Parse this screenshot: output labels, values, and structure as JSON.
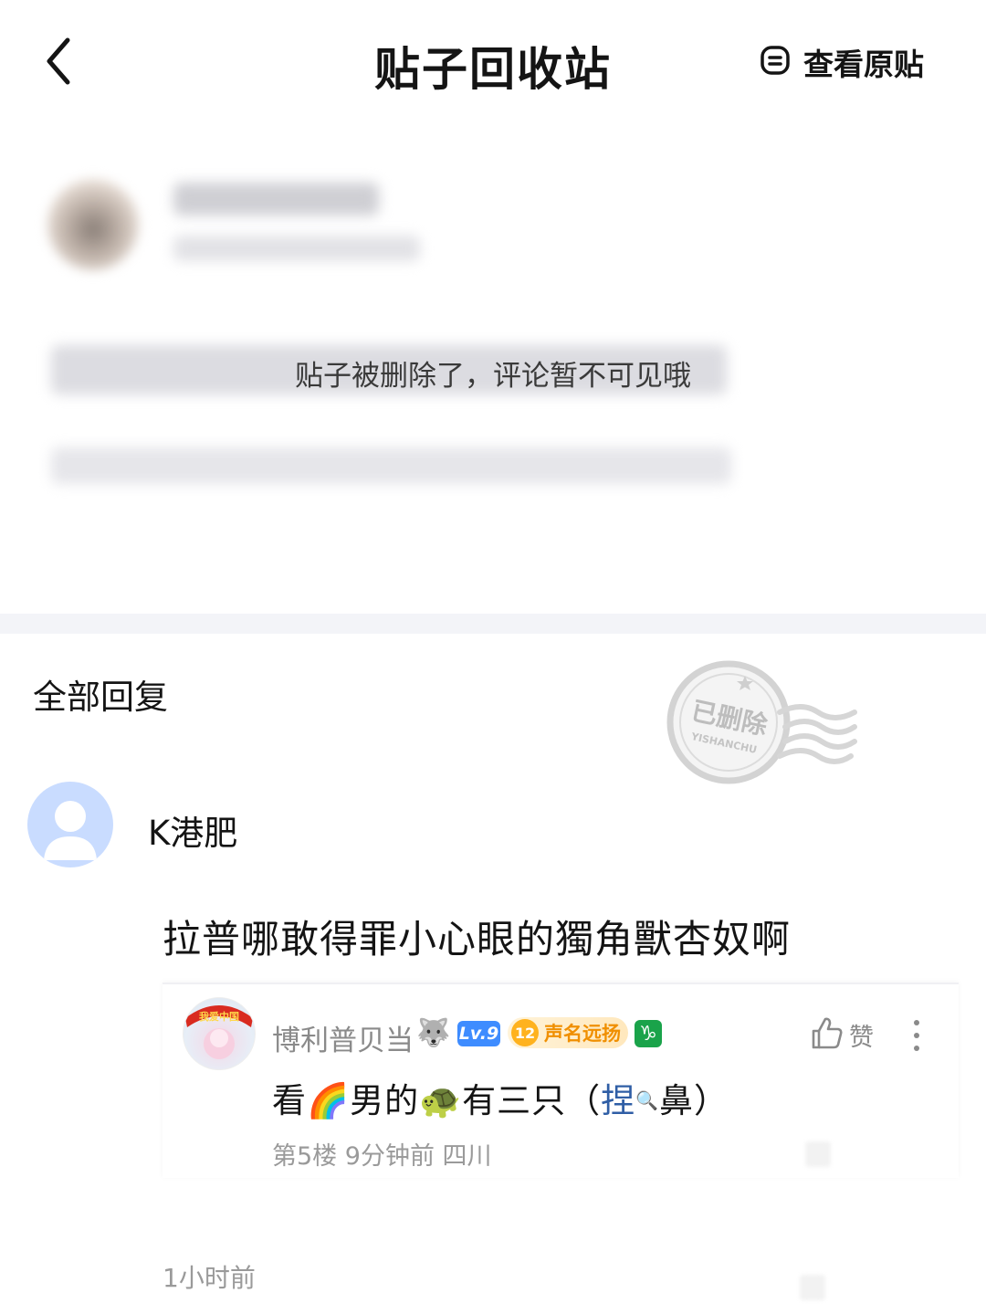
{
  "header": {
    "title": "贴子回收站",
    "view_original_label": "查看原贴"
  },
  "deleted_post": {
    "notice": "贴子被删除了，评论暂不可见哦"
  },
  "replies_section": {
    "title": "全部回复",
    "stamp_text": "已删除",
    "stamp_subtext": "YISHANCHU"
  },
  "comment": {
    "username": "K港肥",
    "text": "拉普哪敢得罪小心眼的獨角獸杏奴啊",
    "time": "1小时前"
  },
  "sub_reply": {
    "avatar_banner": "我爱中国",
    "username": "博利普贝当",
    "username_emoji": "🐺",
    "level_badge": "Lv.9",
    "fame_level": "12",
    "fame_label": "声名远扬",
    "zodiac_badge": "♑",
    "like_label": "赞",
    "text_prefix": "看🌈男的🐢有三只（",
    "text_link": "捏",
    "text_search_icon": "🔍",
    "text_suffix": "鼻）",
    "meta": "第5楼 9分钟前 四川"
  }
}
